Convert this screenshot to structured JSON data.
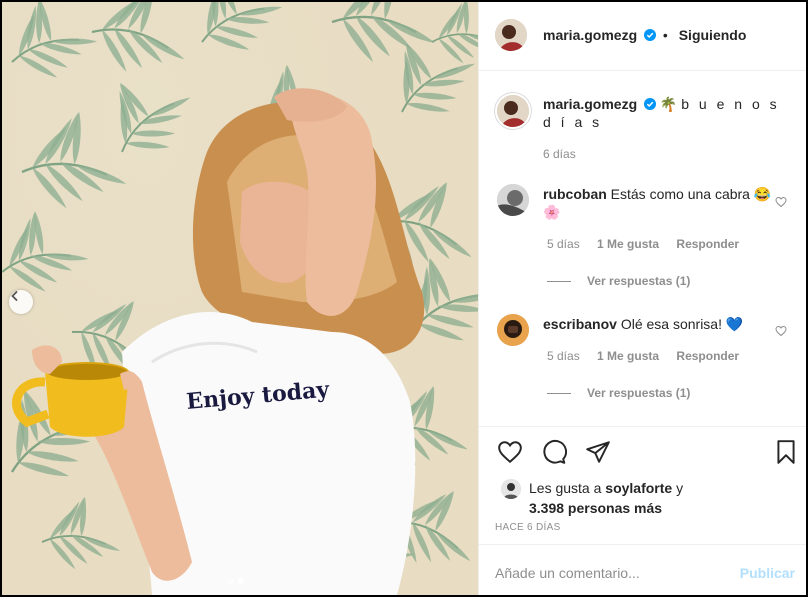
{
  "post": {
    "author": "maria.gomezg",
    "follow_sep": "•",
    "follow_label": "Siguiendo",
    "caption_emoji": "🌴",
    "caption_text": "b u e n o s d í a s",
    "caption_time": "6 días",
    "shirt_text": "Enjoy today"
  },
  "comments": [
    {
      "user": "rubcoban",
      "text": "Estás como una cabra",
      "emoji": "😂🌸",
      "time": "5 días",
      "likes": "1 Me gusta",
      "reply": "Responder",
      "view_replies": "Ver respuestas (1)"
    },
    {
      "user": "escribanov",
      "text": "Olé esa sonrisa!",
      "emoji": "💙",
      "time": "5 días",
      "likes": "1 Me gusta",
      "reply": "Responder",
      "view_replies": "Ver respuestas (1)"
    }
  ],
  "likes": {
    "prefix": "Les gusta a",
    "user": "soylaforte",
    "conj": "y",
    "count": "3.398 personas más"
  },
  "post_age": "HACE 6 DÍAS",
  "add_comment": {
    "placeholder": "Añade un comentario...",
    "publish": "Publicar"
  },
  "carousel": {
    "current": 2,
    "total": 2
  },
  "colors": {
    "verified": "#0095f6",
    "publish_disabled": "#b2dffc",
    "muted": "#8e8e8e",
    "mug": "#f1bd1e"
  }
}
